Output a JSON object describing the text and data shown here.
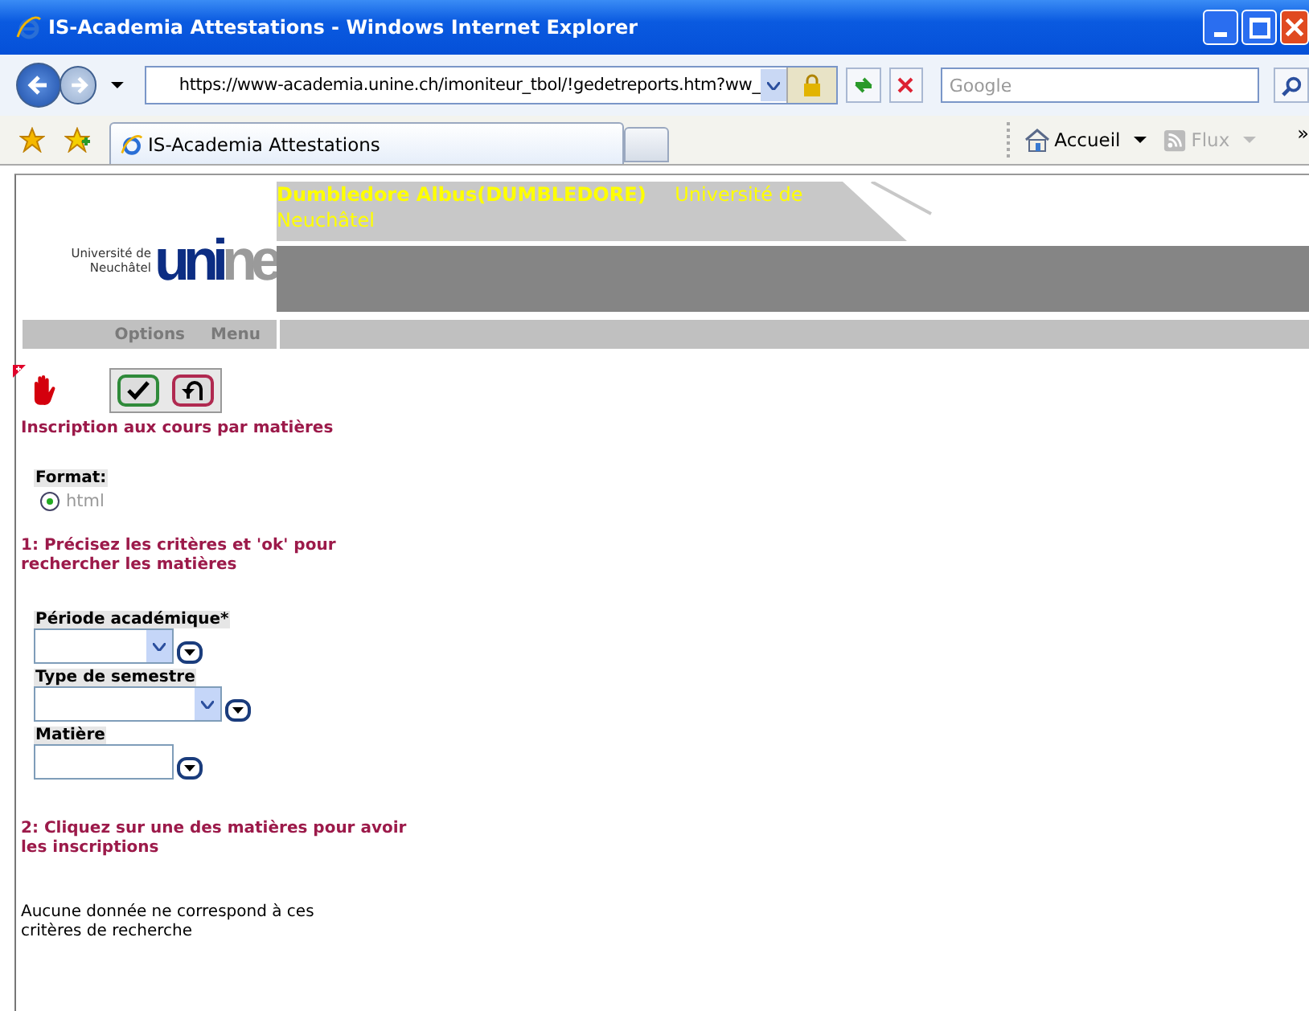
{
  "window": {
    "title": "IS-Academia Attestations - Windows Internet Explorer"
  },
  "toolbar": {
    "address": "https://www-academia.unine.ch/imoniteur_tbol/!gedetreports.htm?ww_",
    "search": {
      "placeholder": "Google"
    }
  },
  "tabs": [
    {
      "label": "IS-Academia Attestations",
      "selected": true
    }
  ],
  "links": [
    {
      "label": "Accueil",
      "disabled": false
    },
    {
      "label": "Flux",
      "disabled": true
    }
  ],
  "overflow": "»",
  "header": {
    "logo": {
      "caption": "Université de Neuchâtel",
      "wordmark_a": "uni",
      "wordmark_b": "ne"
    },
    "user": "Dumbledore Albus(DUMBLEDORE)",
    "institution": "Université de Neuchâtel"
  },
  "menu": [
    "Options",
    "Menu"
  ],
  "form": {
    "title": "Inscription aux cours par matières",
    "format": {
      "label": "Format:",
      "options": [
        {
          "label": "html",
          "selected": true
        }
      ]
    },
    "step_1": "1: Précisez les critères et 'ok' pour rechercher les matières",
    "fields": [
      {
        "label": "Période académique*",
        "kind": "select"
      },
      {
        "label": "Type de semestre",
        "kind": "select-wide"
      },
      {
        "label": "Matière",
        "kind": "text"
      }
    ],
    "step_2": "2: Cliquez sur une des matières pour avoir les inscriptions",
    "empty_message": "Aucune donnée ne correspond à ces critères de recherche"
  }
}
